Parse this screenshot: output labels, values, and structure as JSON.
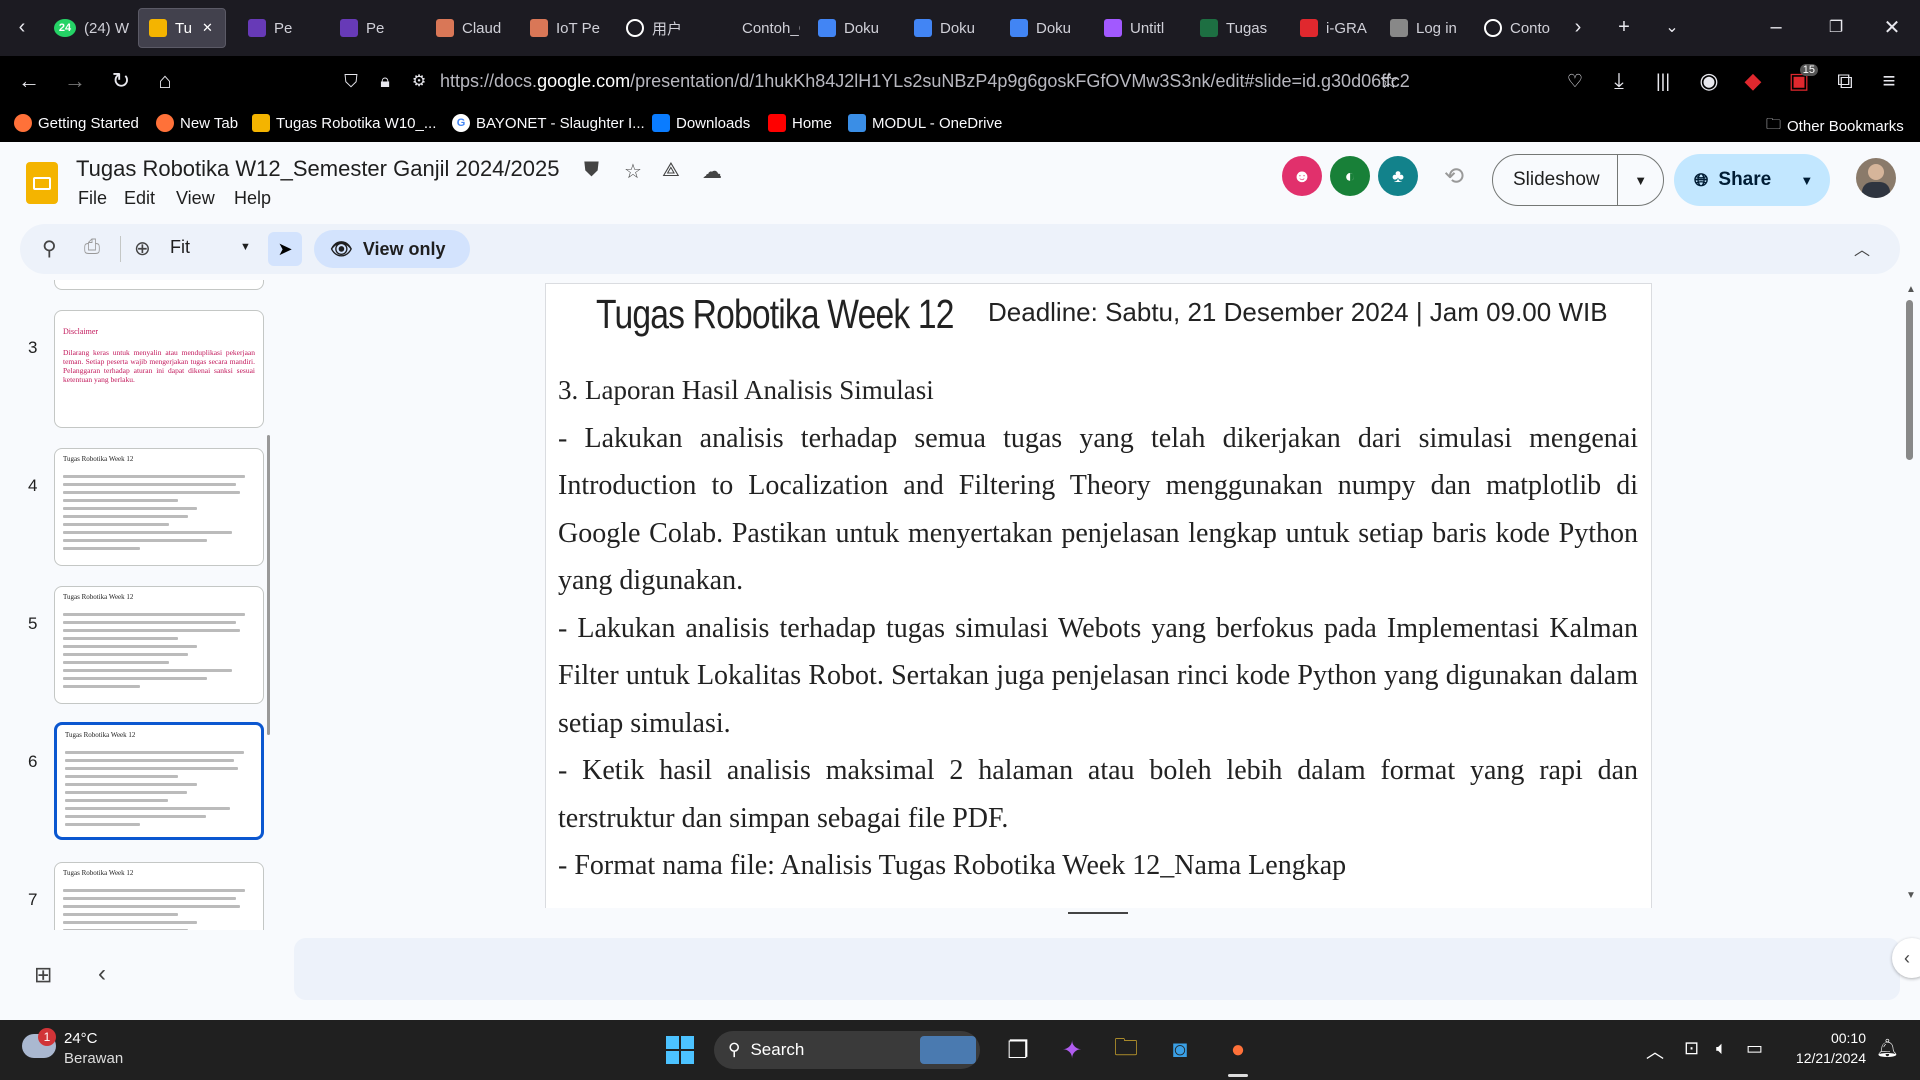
{
  "browser": {
    "tabs": [
      {
        "label": "(24) W",
        "icon": "whatsapp-icon",
        "color": "#25d366",
        "badge": "24"
      },
      {
        "label": "Tu",
        "icon": "slides-icon",
        "color": "#f4b400",
        "active": true
      },
      {
        "label": "Pe",
        "icon": "forms-icon",
        "color": "#673ab7"
      },
      {
        "label": "Pe",
        "icon": "forms-icon",
        "color": "#673ab7"
      },
      {
        "label": "Claud",
        "icon": "claude-icon",
        "color": "#d97757"
      },
      {
        "label": "IoT Pe",
        "icon": "claude-spark-icon",
        "color": "#d97757"
      },
      {
        "label": "用户",
        "icon": "chatgpt-icon",
        "color": "#ffffff"
      },
      {
        "label": "Contoh_C",
        "icon": "blank-icon",
        "color": "#1c1b22"
      },
      {
        "label": "Doku",
        "icon": "docs-icon",
        "color": "#4285f4"
      },
      {
        "label": "Doku",
        "icon": "docs-icon",
        "color": "#4285f4"
      },
      {
        "label": "Doku",
        "icon": "docs-icon",
        "color": "#4285f4"
      },
      {
        "label": "Untitl",
        "icon": "figma-icon",
        "color": "#a259ff"
      },
      {
        "label": "Tugas",
        "icon": "excel-icon",
        "color": "#1d6f42"
      },
      {
        "label": "i-GRA",
        "icon": "igracias-icon",
        "color": "#e0282e"
      },
      {
        "label": "Log in",
        "icon": "login-icon",
        "color": "#888888"
      },
      {
        "label": "Conto",
        "icon": "chatgpt-icon",
        "color": "#ffffff"
      }
    ],
    "url_prefix": "https://docs.",
    "url_domain": "google.com",
    "url_rest": "/presentation/d/1hukKh84J2lH1YLs2suNBzP4p9g6goskFGfOVMw3S3nk/edit#slide=id.g30d06ffc2",
    "extension_badge": "15",
    "bookmarks": [
      {
        "label": "Getting Started",
        "icon": "firefox-icon"
      },
      {
        "label": "New Tab",
        "icon": "firefox-icon"
      },
      {
        "label": "Tugas Robotika W10_...",
        "icon": "slides-icon"
      },
      {
        "label": "BAYONET - Slaughter I...",
        "icon": "google-icon"
      },
      {
        "label": "Downloads",
        "icon": "meta-icon"
      },
      {
        "label": "Home",
        "icon": "youtube-icon"
      },
      {
        "label": "MODUL - OneDrive",
        "icon": "onedrive-icon"
      }
    ],
    "other_bookmarks": "Other Bookmarks"
  },
  "docs": {
    "title": "Tugas Robotika W12_Semester Ganjil 2024/2025",
    "menu": [
      "File",
      "Edit",
      "View",
      "Help"
    ],
    "slideshow_label": "Slideshow",
    "share_label": "Share",
    "zoom_label": "Fit",
    "view_only_label": "View only"
  },
  "filmstrip": [
    {
      "num": "3",
      "title": "Disclaimer",
      "kind": "disclaimer",
      "text": "Dilarang keras untuk menyalin atau menduplikasi pekerjaan teman. Setiap peserta wajib mengerjakan tugas secara mandiri. Pelanggaran terhadap aturan ini dapat dikenai sanksi sesuai ketentuan yang berlaku."
    },
    {
      "num": "4",
      "title": "Tugas Robotika Week 12",
      "kind": "normal"
    },
    {
      "num": "5",
      "title": "Tugas Robotika Week 12",
      "kind": "normal"
    },
    {
      "num": "6",
      "title": "Tugas Robotika Week 12",
      "kind": "normal",
      "selected": true
    },
    {
      "num": "7",
      "title": "Tugas Robotika Week 12",
      "kind": "normal"
    }
  ],
  "slide": {
    "title": "Tugas Robotika Week 12",
    "deadline": "Deadline: Sabtu, 21 Desember 2024  | Jam 09.00 WIB",
    "heading": "3. Laporan Hasil Analisis Simulasi",
    "paragraphs": [
      "- Lakukan analisis terhadap semua tugas yang telah dikerjakan dari simulasi mengenai Introduction to Localization and Filtering Theory menggunakan numpy dan matplotlib di Google Colab. Pastikan untuk menyertakan penjelasan lengkap untuk setiap baris kode Python yang digunakan.",
      "- Lakukan analisis terhadap tugas simulasi Webots yang berfokus pada  Implementasi Kalman Filter untuk Lokalitas Robot. Sertakan juga penjelasan rinci kode Python yang digunakan dalam setiap simulasi.",
      "- Ketik hasil analisis maksimal 2 halaman atau boleh lebih dalam format yang rapi dan terstruktur dan simpan sebagai file PDF.",
      "- Format nama file: Analisis Tugas Robotika Week 12_Nama Lengkap"
    ]
  },
  "taskbar": {
    "weather_temp": "24°C",
    "weather_desc": "Berawan",
    "weather_badge": "1",
    "search_label": "Search",
    "time": "00:10",
    "date": "12/21/2024"
  }
}
